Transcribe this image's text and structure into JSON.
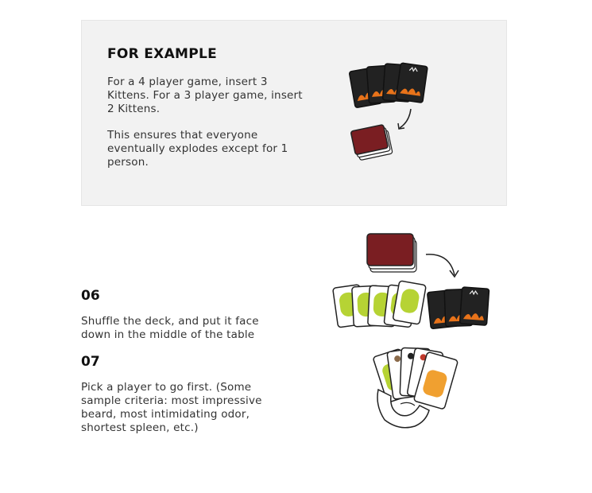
{
  "example": {
    "title": "FOR EXAMPLE",
    "paragraph1": "For a 4 player game, insert 3 Kittens. For a 3 player game, insert 2 Kittens.",
    "paragraph2": "This ensures that everyone eventually explodes except for 1 person."
  },
  "steps": [
    {
      "number": "06",
      "text": "Shuffle the deck, and put it face down in the middle of the table"
    },
    {
      "number": "07",
      "text": "Pick a player to go first. (Some sample criteria: most impressive beard, most intimidating odor, shortest spleen, etc.)"
    }
  ],
  "colors": {
    "box_background": "#f2f2f2",
    "card_back": "#7a1e22",
    "kitten_card": "#222222",
    "flame": "#e8731a",
    "green_card": "#b6d334",
    "orange_card": "#f0a030"
  }
}
